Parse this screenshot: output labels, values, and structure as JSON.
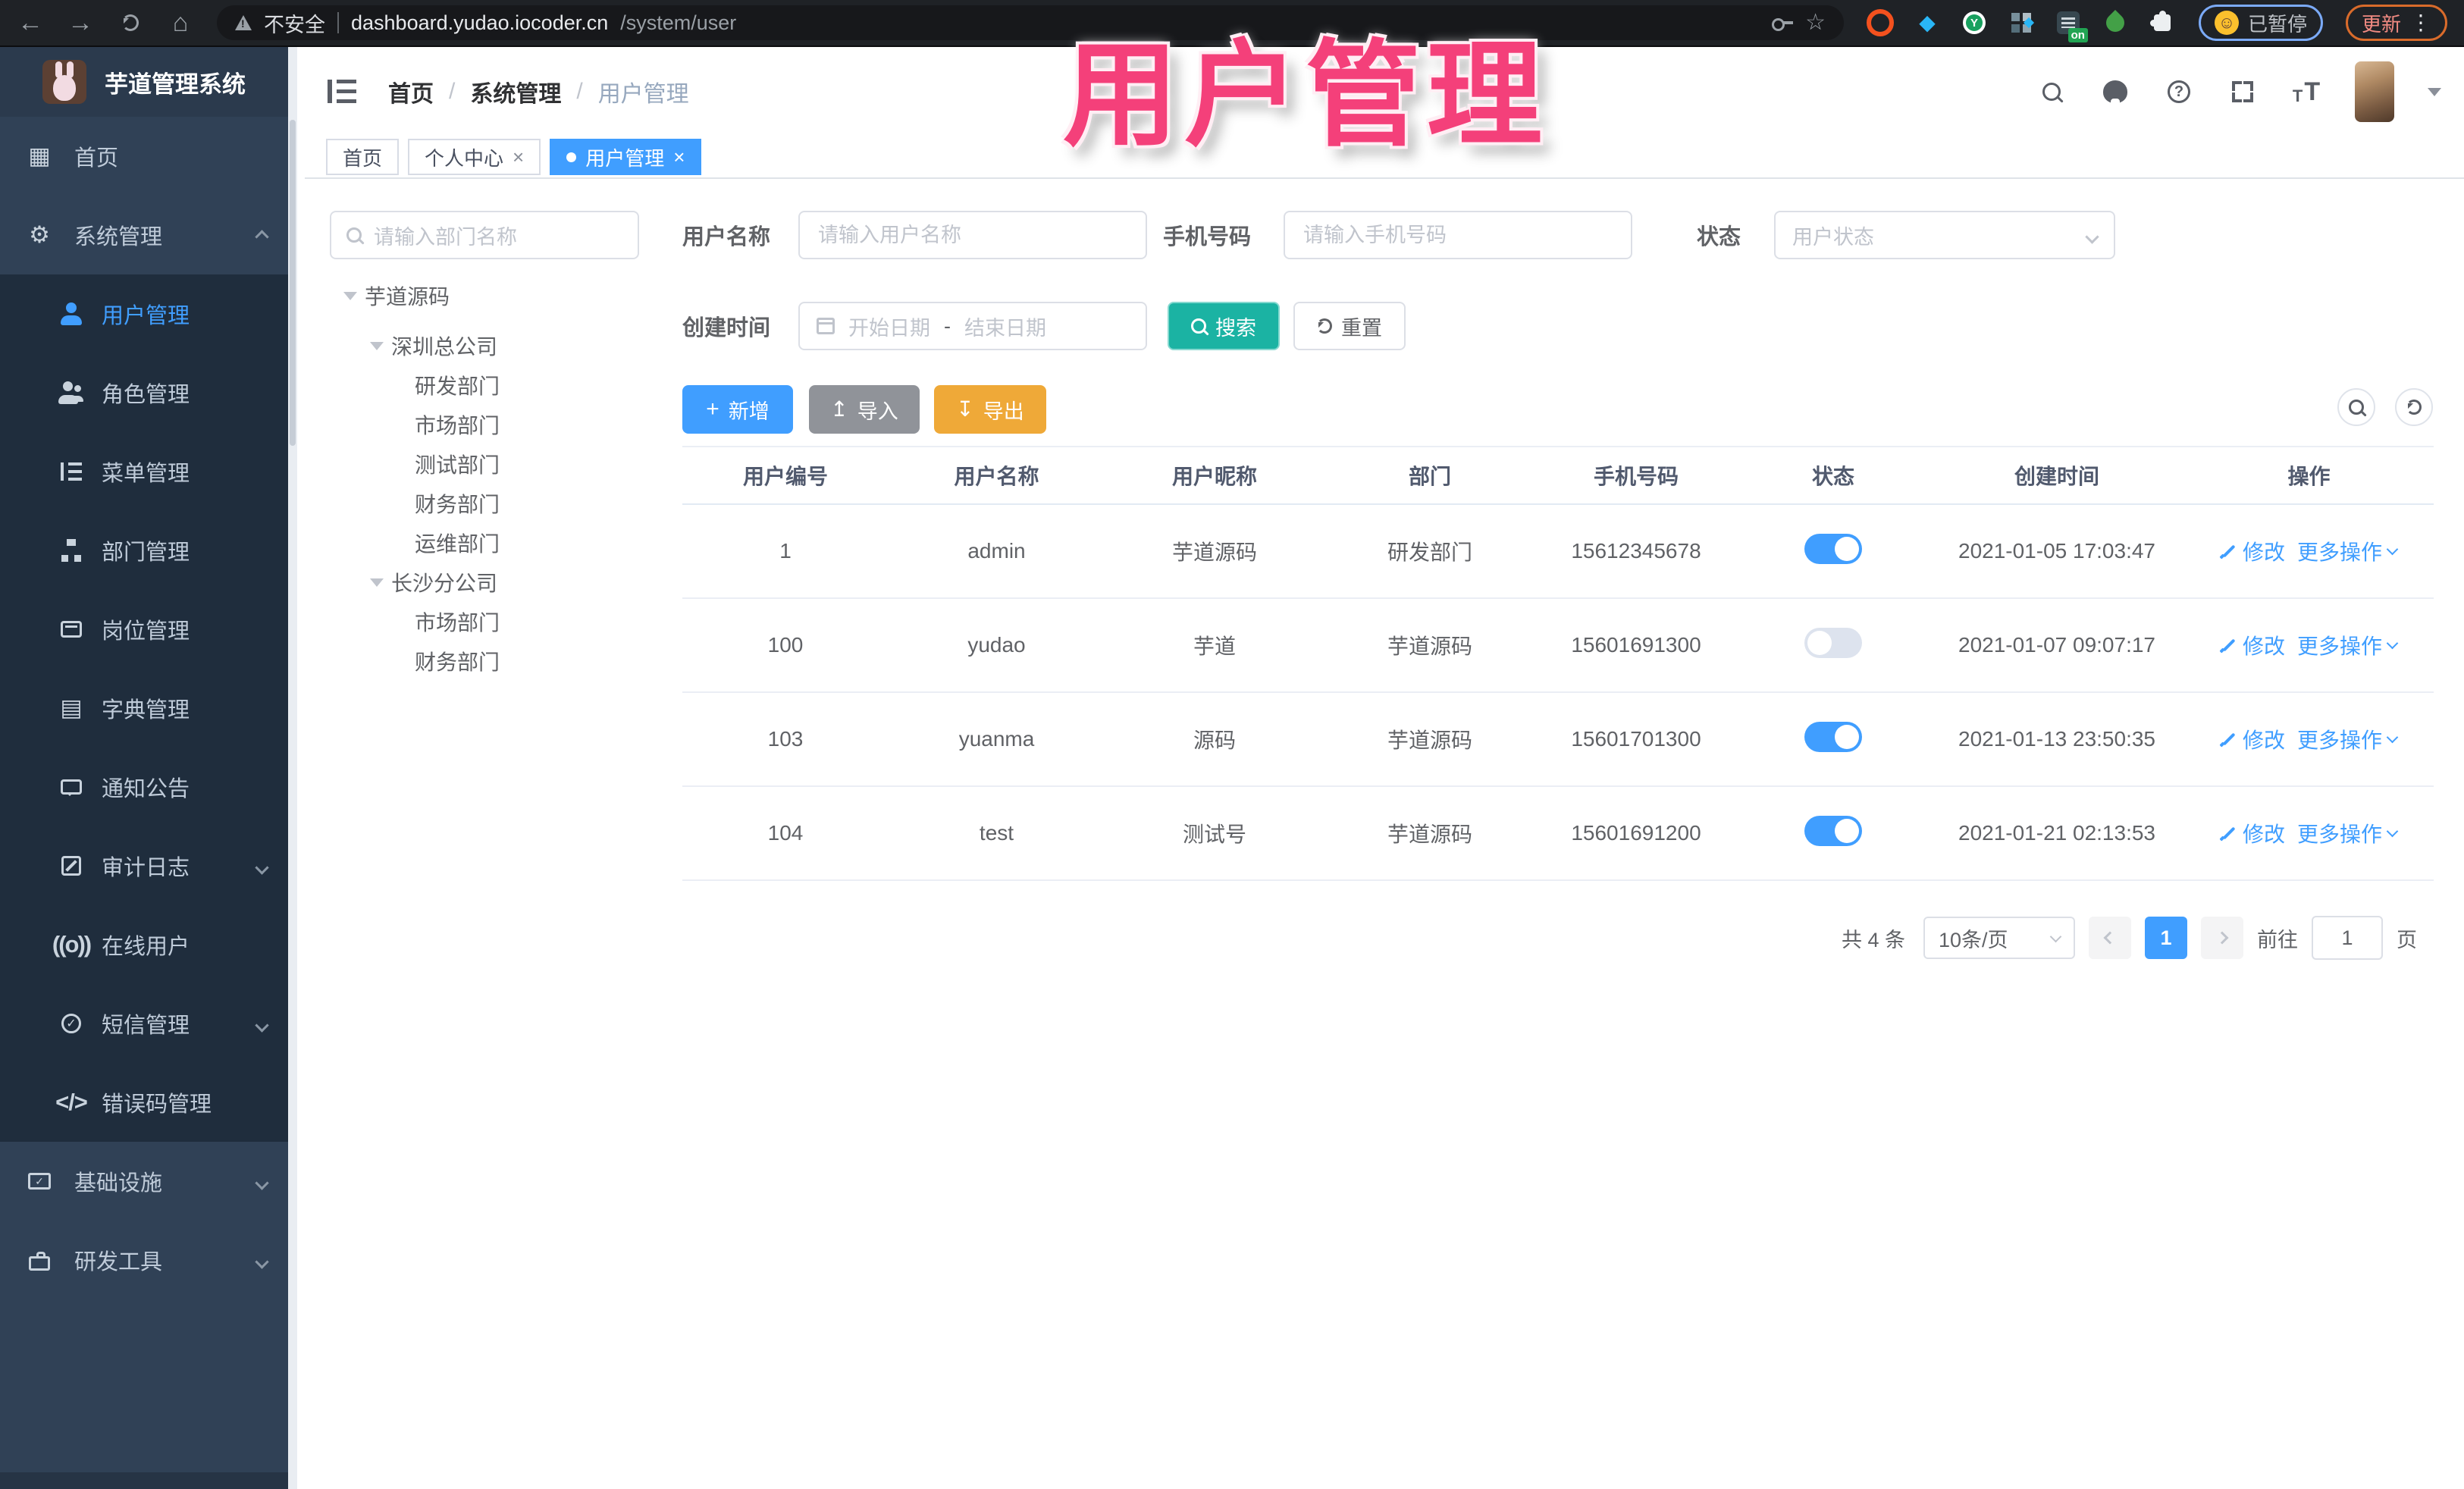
{
  "colors": {
    "primary_blue": "#409eff",
    "search_teal": "#1bb3a3",
    "export_orange": "#efa938",
    "import_grey": "#909399",
    "sidebar_bg": "#304156",
    "submenu_bg": "#1f2d3d",
    "overlay_pink": "#f4407a"
  },
  "browser": {
    "security_label": "不安全",
    "url_host": "dashboard.yudao.iocoder.cn",
    "url_path": "/system/user",
    "extension_badge": "on",
    "profile_status": "已暂停",
    "update_label": "更新"
  },
  "app": {
    "logo_title": "芋道管理系统"
  },
  "sidebar": {
    "items": [
      {
        "label": "首页"
      },
      {
        "label": "系统管理"
      },
      {
        "label": "用户管理"
      },
      {
        "label": "角色管理"
      },
      {
        "label": "菜单管理"
      },
      {
        "label": "部门管理"
      },
      {
        "label": "岗位管理"
      },
      {
        "label": "字典管理"
      },
      {
        "label": "通知公告"
      },
      {
        "label": "审计日志"
      },
      {
        "label": "在线用户"
      },
      {
        "label": "短信管理"
      },
      {
        "label": "错误码管理"
      },
      {
        "label": "基础设施"
      },
      {
        "label": "研发工具"
      }
    ]
  },
  "breadcrumb": {
    "sep": "/",
    "items": [
      "首页",
      "系统管理",
      "用户管理"
    ]
  },
  "tabs": [
    {
      "label": "首页"
    },
    {
      "label": "个人中心",
      "close": "×"
    },
    {
      "label": "用户管理",
      "close": "×"
    }
  ],
  "dept_panel": {
    "search_placeholder": "请输入部门名称",
    "tree": [
      {
        "label": "芋道源码"
      },
      {
        "label": "深圳总公司"
      },
      {
        "label": "研发部门"
      },
      {
        "label": "市场部门"
      },
      {
        "label": "测试部门"
      },
      {
        "label": "财务部门"
      },
      {
        "label": "运维部门"
      },
      {
        "label": "长沙分公司"
      },
      {
        "label": "市场部门"
      },
      {
        "label": "财务部门"
      }
    ]
  },
  "filters": {
    "username_label": "用户名称",
    "username_placeholder": "请输入用户名称",
    "mobile_label": "手机号码",
    "mobile_placeholder": "请输入手机号码",
    "status_label": "状态",
    "status_placeholder": "用户状态",
    "date_label": "创建时间",
    "date_start": "开始日期",
    "date_sep": "-",
    "date_end": "结束日期",
    "search": "搜索",
    "reset": "重置"
  },
  "toolbar": {
    "add": "新增",
    "import": "导入",
    "export": "导出"
  },
  "table": {
    "columns": [
      "用户编号",
      "用户名称",
      "用户昵称",
      "部门",
      "手机号码",
      "状态",
      "创建时间",
      "操作"
    ],
    "edit": "修改",
    "more": "更多操作",
    "rows": [
      {
        "id": "1",
        "username": "admin",
        "nickname": "芋道源码",
        "dept": "研发部门",
        "mobile": "15612345678",
        "status": "on",
        "created": "2021-01-05 17:03:47"
      },
      {
        "id": "100",
        "username": "yudao",
        "nickname": "芋道",
        "dept": "芋道源码",
        "mobile": "15601691300",
        "status": "off",
        "created": "2021-01-07 09:07:17"
      },
      {
        "id": "103",
        "username": "yuanma",
        "nickname": "源码",
        "dept": "芋道源码",
        "mobile": "15601701300",
        "status": "on",
        "created": "2021-01-13 23:50:35"
      },
      {
        "id": "104",
        "username": "test",
        "nickname": "测试号",
        "dept": "芋道源码",
        "mobile": "15601691200",
        "status": "on",
        "created": "2021-01-21 02:13:53"
      }
    ]
  },
  "pagination": {
    "total": "共 4 条",
    "page_size": "10条/页",
    "page": "1",
    "goto": "前往",
    "goto_value": "1",
    "unit": "页"
  },
  "overlay": {
    "title": "用户管理"
  }
}
